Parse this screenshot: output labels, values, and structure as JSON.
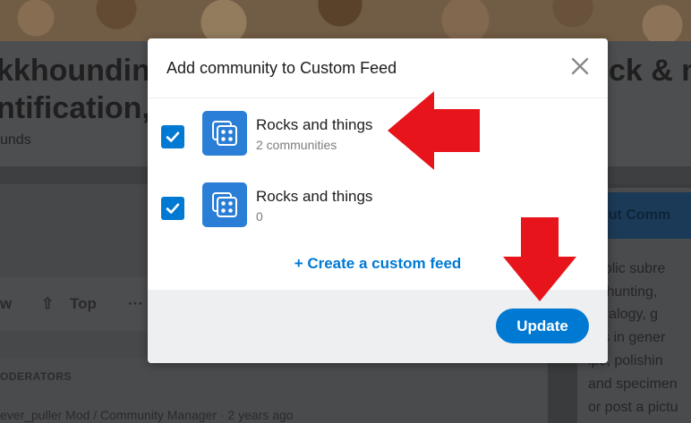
{
  "background": {
    "title_left_line1": "kkhounding",
    "title_left_line2": "ntification,",
    "title_right": "ck & m",
    "subtitle": "unds",
    "sort_items": [
      "w",
      "Top",
      "···"
    ],
    "moderators_label": "ODERATORS",
    "moderator_line": "ever_puller  Mod / Community Manager · 2 years ago",
    "sidebar_header": "out Comm",
    "sidebar_lines": [
      "public subre",
      "ck hunting,",
      "neralogy, g",
      "cks in gener",
      "ips, polishin",
      "and specimen",
      "or post a pictu"
    ]
  },
  "modal": {
    "title": "Add community to Custom Feed",
    "close_icon": "close-icon",
    "feeds": [
      {
        "name": "Rocks and things",
        "count": "2 communities",
        "checked": true
      },
      {
        "name": "Rocks and things",
        "count": "0",
        "checked": true
      }
    ],
    "create_link": "+ Create a custom feed",
    "update_label": "Update"
  },
  "colors": {
    "accent": "#0079d3",
    "arrow": "#e8141b",
    "feed_icon": "#2a7ed6"
  }
}
